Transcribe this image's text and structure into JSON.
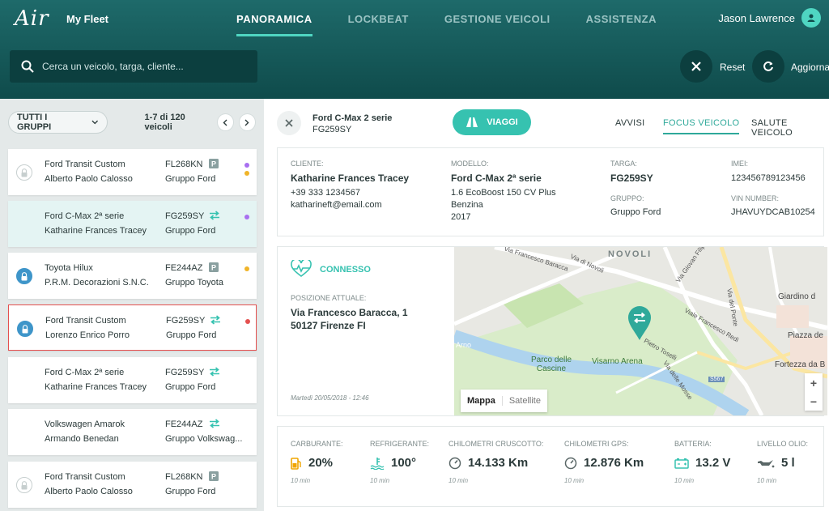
{
  "header": {
    "logo": "Air",
    "app_name": "My Fleet",
    "nav": [
      "PANORAMICA",
      "LOCKBEAT",
      "GESTIONE VEICOLI",
      "ASSISTENZA"
    ],
    "user_name": "Jason Lawrence",
    "search_placeholder": "Cerca un veicolo, targa, cliente...",
    "reset_label": "Reset",
    "refresh_label": "Aggiorna"
  },
  "list": {
    "group_filter": "TUTTI I GRUPPI",
    "count": "1-7 di 120 veicoli",
    "items": [
      {
        "model": "Ford Transit Custom",
        "owner": "Alberto Paolo Calosso",
        "plate": "FL268KN",
        "group": "Gruppo Ford",
        "status_icon": "parking-icon",
        "lock": "off",
        "dots": [
          "#a86ff0",
          "#f0b429"
        ]
      },
      {
        "model": "Ford C-Max 2ª serie",
        "owner": "Katharine Frances Tracey",
        "plate": "FG259SY",
        "group": "Gruppo Ford",
        "status_icon": "swap-icon",
        "lock": "none",
        "dots": [
          "#a86ff0"
        ]
      },
      {
        "model": "Toyota Hilux",
        "owner": "P.R.M. Decorazioni S.N.C.",
        "plate": "FE244AZ",
        "group": "Gruppo Toyota",
        "status_icon": "parking-icon",
        "lock": "on",
        "dots": [
          "#f0b429"
        ]
      },
      {
        "model": "Ford Transit Custom",
        "owner": "Lorenzo Enrico Porro",
        "plate": "FG259SY",
        "group": "Gruppo Ford",
        "status_icon": "swap-icon",
        "lock": "on",
        "dots": [
          "#e4504f"
        ]
      },
      {
        "model": "Ford C-Max 2ª serie",
        "owner": "Katharine Frances Tracey",
        "plate": "FG259SY",
        "group": "Gruppo Ford",
        "status_icon": "swap-icon",
        "lock": "none",
        "dots": []
      },
      {
        "model": "Volkswagen Amarok",
        "owner": "Armando Benedan",
        "plate": "FE244AZ",
        "group": "Gruppo Volkswag...",
        "status_icon": "swap-icon",
        "lock": "none",
        "dots": []
      },
      {
        "model": "Ford Transit Custom",
        "owner": "Alberto Paolo Calosso",
        "plate": "FL268KN",
        "group": "Gruppo Ford",
        "status_icon": "parking-icon",
        "lock": "off",
        "dots": []
      }
    ]
  },
  "detail": {
    "title": "Ford C-Max 2 serie",
    "plate": "FG259SY",
    "trips_button": "VIAGGI",
    "tabs": [
      "AVVISI",
      "FOCUS VEICOLO",
      "SALUTE VEICOLO"
    ],
    "active_tab": "FOCUS VEICOLO",
    "info": {
      "cliente_label": "CLIENTE:",
      "cliente_name": "Katharine Frances Tracey",
      "cliente_phone": "+39 333 1234567",
      "cliente_email": "katharineft@email.com",
      "modello_label": "MODELLO:",
      "modello_name": "Ford C-Max 2ª serie",
      "modello_engine": "1.6 EcoBoost 150 CV Plus",
      "modello_fuel": "Benzina",
      "modello_year": "2017",
      "targa_label": "TARGA:",
      "targa_value": "FG259SY",
      "gruppo_label": "GRUPPO:",
      "gruppo_value": "Gruppo Ford",
      "imei_label": "IMEI:",
      "imei_value": "123456789123456",
      "vin_label": "VIN NUMBER:",
      "vin_value": "JHAVUYDCAB10254"
    },
    "position": {
      "status": "CONNESSO",
      "label": "POSIZIONE ATTUALE:",
      "address_line1": "Via Francesco Baracca, 1",
      "address_line2": "50127 Firenze FI",
      "timestamp": "Martedì 20/05/2018 - 12:46"
    },
    "map": {
      "labels": [
        "NOVOLI",
        "Via Francesco Baracca",
        "Via di Novoli",
        "Via Giovan Filippo",
        "Giardino d",
        "Viale Francesco Redi",
        "Via del Ponte",
        "Piazza de",
        "Parco delle Cascine",
        "Visarno Arena",
        "Fortezza da B",
        "Arno",
        "Pietro Toselli",
        "S567",
        "Via delle Mosse"
      ],
      "mode_map": "Mappa",
      "mode_satellite": "Satellite",
      "active_mode": "Mappa"
    },
    "metrics": [
      {
        "label": "CARBURANTE:",
        "value": "20%",
        "icon": "fuel-icon",
        "time": "10 min"
      },
      {
        "label": "REFRIGERANTE:",
        "value": "100°",
        "icon": "coolant-icon",
        "time": "10 min"
      },
      {
        "label": "CHILOMETRI CRUSCOTTO:",
        "value": "14.133 Km",
        "icon": "speedometer-icon",
        "time": "10 min"
      },
      {
        "label": "CHILOMETRI GPS:",
        "value": "12.876 Km",
        "icon": "gps-odometer-icon",
        "time": "10 min"
      },
      {
        "label": "BATTERIA:",
        "value": "13.2 V",
        "icon": "battery-icon",
        "time": "10 min"
      },
      {
        "label": "LIVELLO OLIO:",
        "value": "5 l",
        "icon": "oil-icon",
        "time": "10 min"
      }
    ]
  }
}
